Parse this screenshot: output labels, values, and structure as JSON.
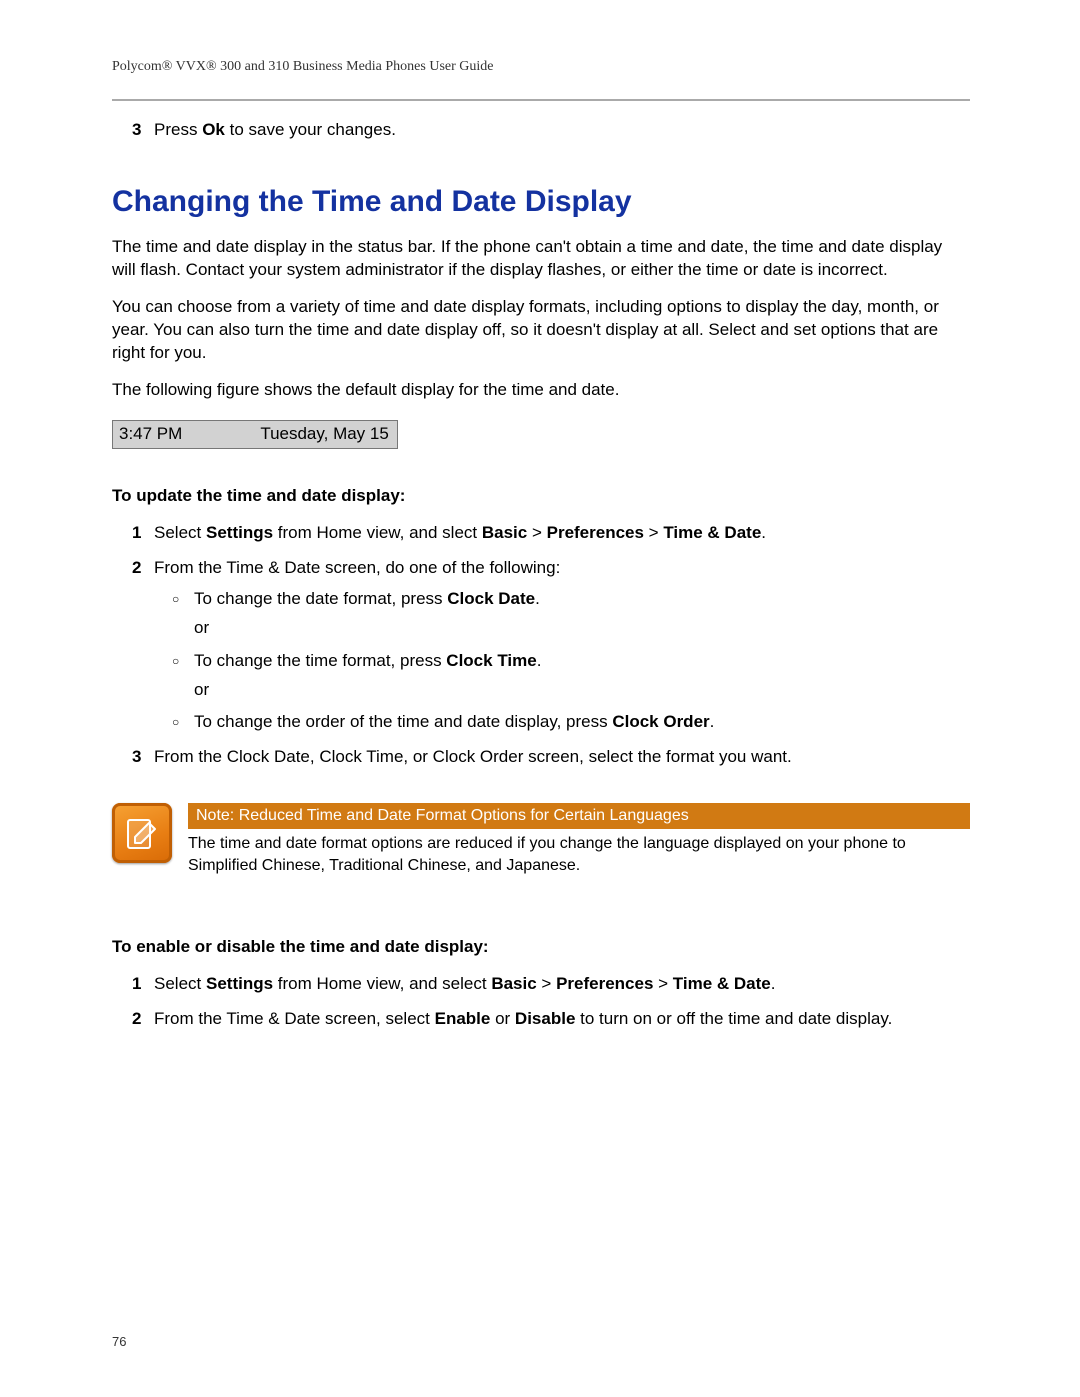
{
  "header": "Polycom® VVX® 300 and 310 Business Media Phones User Guide",
  "carryover_step": {
    "num": "3",
    "pre": "Press ",
    "bold": "Ok",
    "post": " to save your changes."
  },
  "h2": "Changing the Time and Date Display",
  "p1": "The time and date display in the status bar. If the phone can't obtain a time and date, the time and date display will flash. Contact your system administrator if the display flashes, or either the time or date is incorrect.",
  "p2": "You can choose from a variety of time and date display formats, including options to display the day, month, or year. You can also turn the time and date display off, so it doesn't display at all. Select and set options that are right for you.",
  "p3": "The following figure shows the default display for the time and date.",
  "figure": {
    "time": "3:47 PM",
    "date": "Tuesday, May 15"
  },
  "procA_head": "To update the time and date display:",
  "procA": {
    "s1": {
      "num": "1",
      "pre": "Select ",
      "b1": "Settings",
      "mid": " from Home view, and slect ",
      "b2": "Basic",
      "gt1": " > ",
      "b3": "Preferences",
      "gt2": " > ",
      "b4": "Time & Date",
      "end": "."
    },
    "s2": {
      "num": "2",
      "text": "From the Time & Date screen, do one of the following:"
    },
    "sub1": {
      "pre": "To change the date format, press ",
      "b": "Clock Date",
      "end": "."
    },
    "or": "or",
    "sub2": {
      "pre": "To change the time format, press ",
      "b": "Clock Time",
      "end": "."
    },
    "sub3": {
      "pre": "To change the order of the time and date display, press ",
      "b": "Clock Order",
      "end": "."
    },
    "s3": {
      "num": "3",
      "text": "From the Clock Date, Clock Time, or Clock Order screen, select the format you want."
    }
  },
  "note": {
    "title": "Note: Reduced Time and Date Format Options for Certain Languages",
    "body": "The time and date format options are reduced if you change the language displayed on your phone to Simplified Chinese, Traditional Chinese, and Japanese."
  },
  "procB_head": "To enable or disable the time and date display:",
  "procB": {
    "s1": {
      "num": "1",
      "pre": "Select ",
      "b1": "Settings",
      "mid": " from Home view, and select ",
      "b2": "Basic",
      "gt1": " > ",
      "b3": "Preferences",
      "gt2": " > ",
      "b4": "Time & Date",
      "end": "."
    },
    "s2": {
      "num": "2",
      "pre": "From the Time & Date screen, select ",
      "b1": "Enable",
      "mid": " or ",
      "b2": "Disable",
      "post": " to turn on or off the time and date display."
    }
  },
  "page_num": "76"
}
